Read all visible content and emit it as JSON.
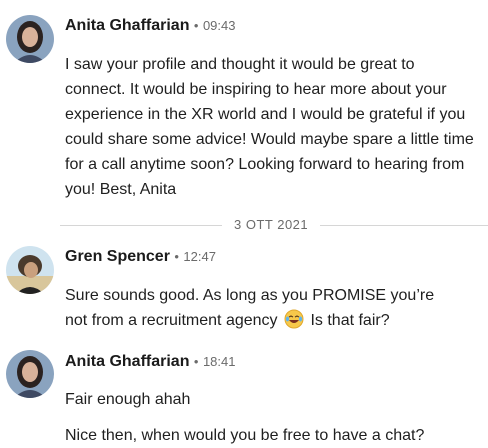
{
  "messages": [
    {
      "sender": "Anita Ghaffarian",
      "separator": "•",
      "time": "09:43",
      "lines": [
        "I saw your profile and thought it would be great to connect. It would be inspiring to hear more about your experience in the XR world and I would be grateful if you could share some advice! Would maybe spare a little time for a call anytime soon? Looking forward to hearing from you! Best, Anita"
      ]
    },
    {
      "sender": "Gren Spencer",
      "separator": "•",
      "time": "12:47",
      "line1": "Sure sounds good. As long as you PROMISE you’re",
      "line2_pre": "not from a recruitment agency",
      "line2_post": "Is that fair?"
    },
    {
      "sender": "Anita Ghaffarian",
      "separator": "•",
      "time": "18:41",
      "lines": [
        "Fair enough ahah",
        "Nice then, when would you be free to have a chat?"
      ]
    }
  ],
  "date_divider": "3 OTT 2021",
  "icons": {
    "emoji": "laughing-with-tears-emoji"
  }
}
